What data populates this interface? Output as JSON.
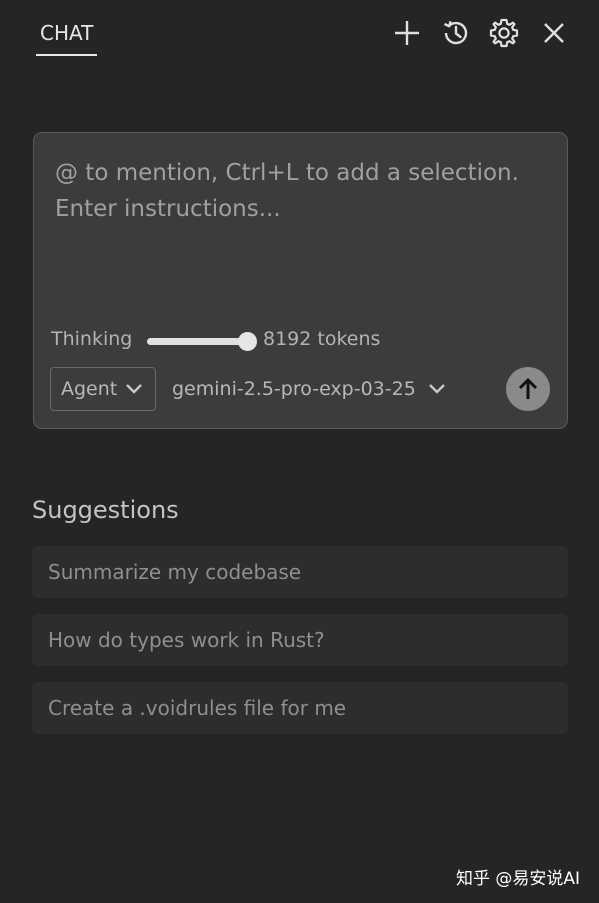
{
  "header": {
    "tab_label": "CHAT",
    "icons": [
      "plus-icon",
      "history-icon",
      "gear-icon",
      "close-icon"
    ]
  },
  "input": {
    "placeholder": "@ to mention, Ctrl+L to add a selection. Enter instructions...",
    "thinking_label": "Thinking",
    "thinking_slider_fraction": 1.0,
    "tokens_label": "8192 tokens",
    "mode_value": "Agent",
    "model_value": "gemini-2.5-pro-exp-03-25",
    "send_icon": "arrow-up-icon"
  },
  "suggestions": {
    "title": "Suggestions",
    "items": [
      "Summarize my codebase",
      "How do types work in Rust?",
      "Create a .voidrules file for me"
    ]
  },
  "watermark": "知乎 @易安说AI",
  "colors": {
    "background": "#252526",
    "input_bg": "#3c3c3c",
    "suggestion_bg": "#2d2d2d",
    "send_button": "#8a8a8a"
  }
}
